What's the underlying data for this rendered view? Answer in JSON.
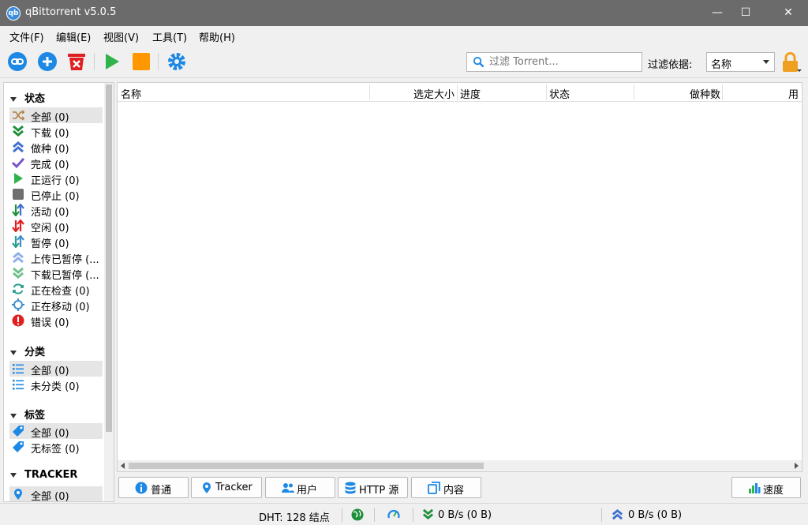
{
  "window": {
    "title": "qBittorrent v5.0.5",
    "app_icon_text": "qb",
    "minimize": "—",
    "maximize": "☐",
    "close": "✕"
  },
  "menu": [
    "文件(F)",
    "编辑(E)",
    "视图(V)",
    "工具(T)",
    "帮助(H)"
  ],
  "toolbar": {
    "search_placeholder": "过滤 Torrent...",
    "filter_label": "过滤依据:",
    "filter_value": "名称"
  },
  "sidebar": {
    "status_header": "状态",
    "status_items": [
      "全部 (0)",
      "下载 (0)",
      "做种 (0)",
      "完成 (0)",
      "正运行 (0)",
      "已停止 (0)",
      "活动 (0)",
      "空闲 (0)",
      "暂停 (0)",
      "上传已暂停 (...",
      "下载已暂停 (...",
      "正在检查 (0)",
      "正在移动 (0)",
      "错误 (0)"
    ],
    "category_header": "分类",
    "category_items": [
      "全部 (0)",
      "未分类 (0)"
    ],
    "tag_header": "标签",
    "tag_items": [
      "全部 (0)",
      "无标签 (0)"
    ],
    "tracker_header": "TRACKER",
    "tracker_items": [
      "全部 (0)"
    ]
  },
  "columns": [
    "名称",
    "选定大小",
    "进度",
    "状态",
    "做种数",
    "用"
  ],
  "tabs": [
    "普通",
    "Tracker",
    "用户",
    "HTTP 源",
    "内容"
  ],
  "speed_button": "速度",
  "status": {
    "dht": "DHT:  128 结点",
    "download": "0 B/s (0 B)",
    "upload": "0 B/s (0 B)"
  },
  "colors": {
    "titlebar": "#6b6b6b",
    "accent_blue": "#1e88e5",
    "play_green": "#2fb34a",
    "stop_orange": "#ff9800",
    "delete_red": "#e02020",
    "lock_orange": "#f0a020"
  }
}
